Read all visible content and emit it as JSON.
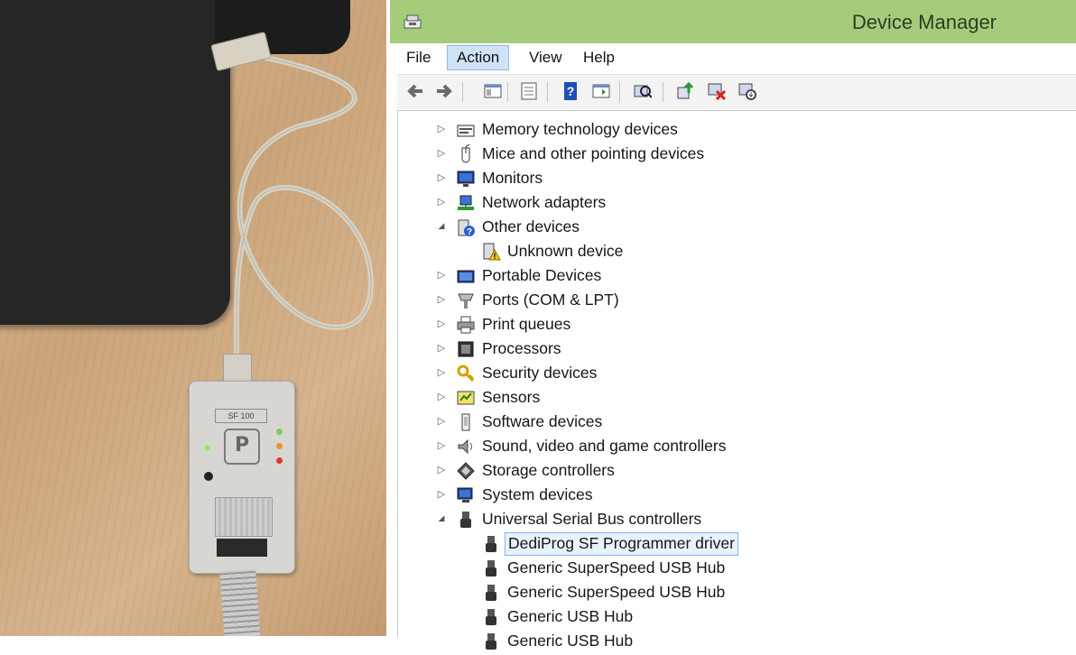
{
  "window": {
    "title": "Device Manager"
  },
  "menubar": [
    {
      "label": "File",
      "active": false
    },
    {
      "label": "Action",
      "active": true
    },
    {
      "label": "View",
      "active": false
    },
    {
      "label": "Help",
      "active": false
    }
  ],
  "toolbar": [
    {
      "icon": "back-arrow-icon"
    },
    {
      "icon": "forward-arrow-icon"
    },
    {
      "icon": "show-hide-console-tree-icon"
    },
    {
      "icon": "properties-icon"
    },
    {
      "icon": "help-icon"
    },
    {
      "icon": "action-pane-icon"
    },
    {
      "icon": "scan-hardware-changes-icon"
    },
    {
      "icon": "update-driver-icon"
    },
    {
      "icon": "uninstall-device-icon"
    },
    {
      "icon": "disable-device-icon"
    }
  ],
  "photo": {
    "device_model": "SF 100",
    "logo_letter": "P"
  },
  "tree": [
    {
      "label": "Memory technology devices",
      "level": 0,
      "expanded": false,
      "icon": "memory-technology-icon"
    },
    {
      "label": "Mice and other pointing devices",
      "level": 0,
      "expanded": false,
      "icon": "mouse-icon"
    },
    {
      "label": "Monitors",
      "level": 0,
      "expanded": false,
      "icon": "monitor-icon"
    },
    {
      "label": "Network adapters",
      "level": 0,
      "expanded": false,
      "icon": "network-adapter-icon"
    },
    {
      "label": "Other devices",
      "level": 0,
      "expanded": true,
      "icon": "other-devices-icon"
    },
    {
      "label": "Unknown device",
      "level": 1,
      "icon": "unknown-device-warning-icon"
    },
    {
      "label": "Portable Devices",
      "level": 0,
      "expanded": false,
      "icon": "portable-device-icon"
    },
    {
      "label": "Ports (COM & LPT)",
      "level": 0,
      "expanded": false,
      "icon": "port-icon"
    },
    {
      "label": "Print queues",
      "level": 0,
      "expanded": false,
      "icon": "printer-icon"
    },
    {
      "label": "Processors",
      "level": 0,
      "expanded": false,
      "icon": "processor-icon"
    },
    {
      "label": "Security devices",
      "level": 0,
      "expanded": false,
      "icon": "security-key-icon"
    },
    {
      "label": "Sensors",
      "level": 0,
      "expanded": false,
      "icon": "sensor-icon"
    },
    {
      "label": "Software devices",
      "level": 0,
      "expanded": false,
      "icon": "software-device-icon"
    },
    {
      "label": "Sound, video and game controllers",
      "level": 0,
      "expanded": false,
      "icon": "speaker-icon"
    },
    {
      "label": "Storage controllers",
      "level": 0,
      "expanded": false,
      "icon": "storage-controller-icon"
    },
    {
      "label": "System devices",
      "level": 0,
      "expanded": false,
      "icon": "system-device-icon"
    },
    {
      "label": "Universal Serial Bus controllers",
      "level": 0,
      "expanded": true,
      "icon": "usb-icon"
    },
    {
      "label": "DediProg SF Programmer driver",
      "level": 1,
      "selected": true,
      "icon": "usb-plug-icon"
    },
    {
      "label": "Generic SuperSpeed USB Hub",
      "level": 1,
      "icon": "usb-plug-icon"
    },
    {
      "label": "Generic SuperSpeed USB Hub",
      "level": 1,
      "icon": "usb-plug-icon"
    },
    {
      "label": "Generic USB Hub",
      "level": 1,
      "icon": "usb-plug-icon"
    },
    {
      "label": "Generic USB Hub",
      "level": 1,
      "icon": "usb-plug-icon"
    }
  ],
  "colors": {
    "titlebar": "#a4cc7a",
    "selection_border": "#7eb4ea",
    "selection_fill": "#e8f2fc",
    "menu_active": "#cfe3f7"
  }
}
